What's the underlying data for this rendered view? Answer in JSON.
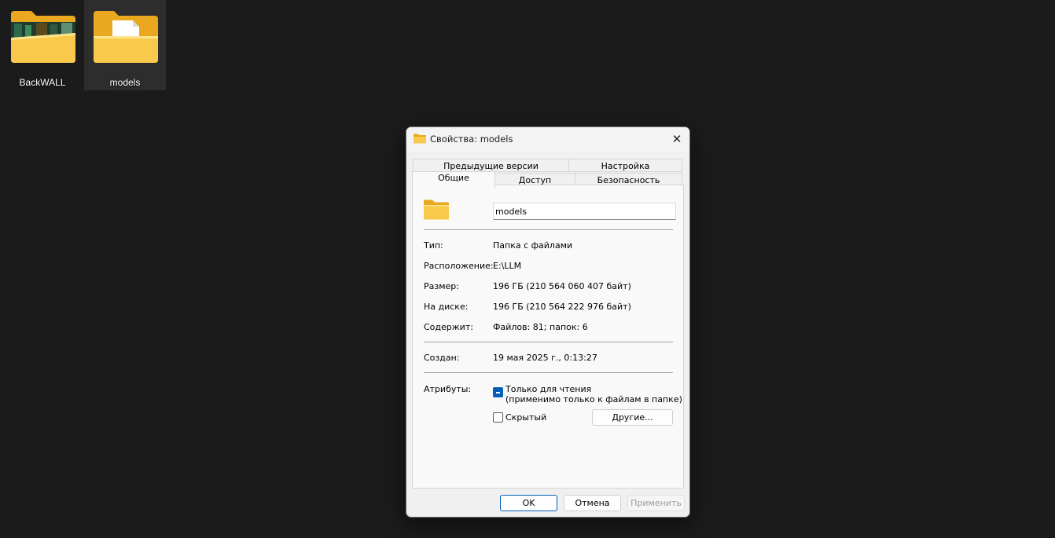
{
  "desktop": {
    "icons": [
      {
        "label": "BackWALL"
      },
      {
        "label": "models"
      }
    ]
  },
  "dialog": {
    "title": "Свойства: models",
    "tabs": {
      "previous_versions": "Предыдущие версии",
      "customize": "Настройка",
      "general": "Общие",
      "sharing": "Доступ",
      "security": "Безопасность"
    },
    "active_tab": "general",
    "name_value": "models",
    "properties": {
      "type_label": "Тип:",
      "type_value": "Папка с файлами",
      "location_label": "Расположение:",
      "location_value": "E:\\LLM",
      "size_label": "Размер:",
      "size_value": "196 ГБ (210 564 060 407 байт)",
      "ondisk_label": "На диске:",
      "ondisk_value": "196 ГБ (210 564 222 976 байт)",
      "contains_label": "Содержит:",
      "contains_value": "Файлов: 81; папок: 6",
      "created_label": "Создан:",
      "created_value": "19 мая 2025 г., 0:13:27"
    },
    "attributes": {
      "label": "Атрибуты:",
      "readonly_label": "Только для чтения",
      "readonly_note": "(применимо только к файлам в папке)",
      "readonly_state": "indeterminate",
      "hidden_label": "Скрытый",
      "hidden_state": "unchecked",
      "advanced_button": "Другие..."
    },
    "buttons": {
      "ok": "OK",
      "cancel": "Отмена",
      "apply": "Применить"
    },
    "colors": {
      "accent": "#005fb8",
      "folder_yellow": "#f8c94a"
    }
  }
}
